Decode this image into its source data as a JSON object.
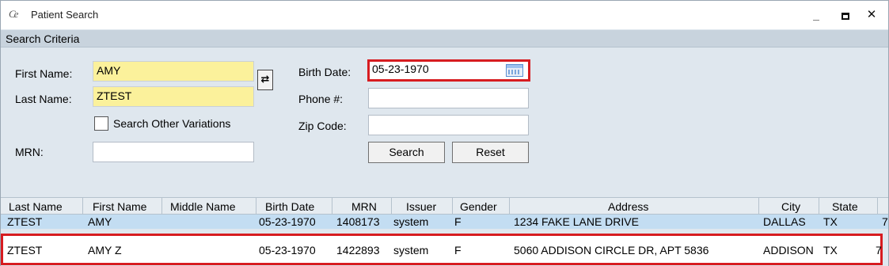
{
  "window": {
    "title": "Patient Search",
    "logo_glyph": "Ce",
    "minimize_glyph": "_",
    "close_glyph": "✕"
  },
  "section": {
    "title": "Search Criteria"
  },
  "form": {
    "first_name_label": "First Name:",
    "first_name_value": "AMY",
    "last_name_label": "Last Name:",
    "last_name_value": "ZTEST",
    "search_variations_label": "Search Other Variations",
    "mrn_label": "MRN:",
    "mrn_value": "",
    "birth_date_label": "Birth Date:",
    "birth_date_value": "05-23-1970",
    "phone_label": "Phone #:",
    "phone_value": "",
    "zip_label": "Zip Code:",
    "zip_value": "",
    "search_button": "Search",
    "reset_button": "Reset",
    "swap_icon": "swap-names-icon"
  },
  "table": {
    "columns": [
      "Last Name",
      "First Name",
      "Middle Name",
      "Birth Date",
      "MRN",
      "Issuer",
      "Gender",
      "Address",
      "City",
      "State"
    ],
    "rows": [
      {
        "last": "ZTEST",
        "first": "AMY",
        "middle": "",
        "dob": "05-23-1970",
        "mrn": "1408173",
        "issuer": "system",
        "gender": "F",
        "address": "1234 FAKE LANE DRIVE",
        "city": "DALLAS",
        "state": "TX",
        "extra": "7"
      },
      {
        "last": "ZTEST",
        "first": "AMY Z",
        "middle": "",
        "dob": "05-23-1970",
        "mrn": "1422893",
        "issuer": "system",
        "gender": "F",
        "address": "5060 ADDISON CIRCLE DR, APT 5836",
        "city": "ADDISON",
        "state": "TX",
        "extra": "7"
      }
    ]
  },
  "colors": {
    "highlight": "#d71c20",
    "selected_row": "#c3ddf2",
    "required_field": "#fbf19b"
  }
}
